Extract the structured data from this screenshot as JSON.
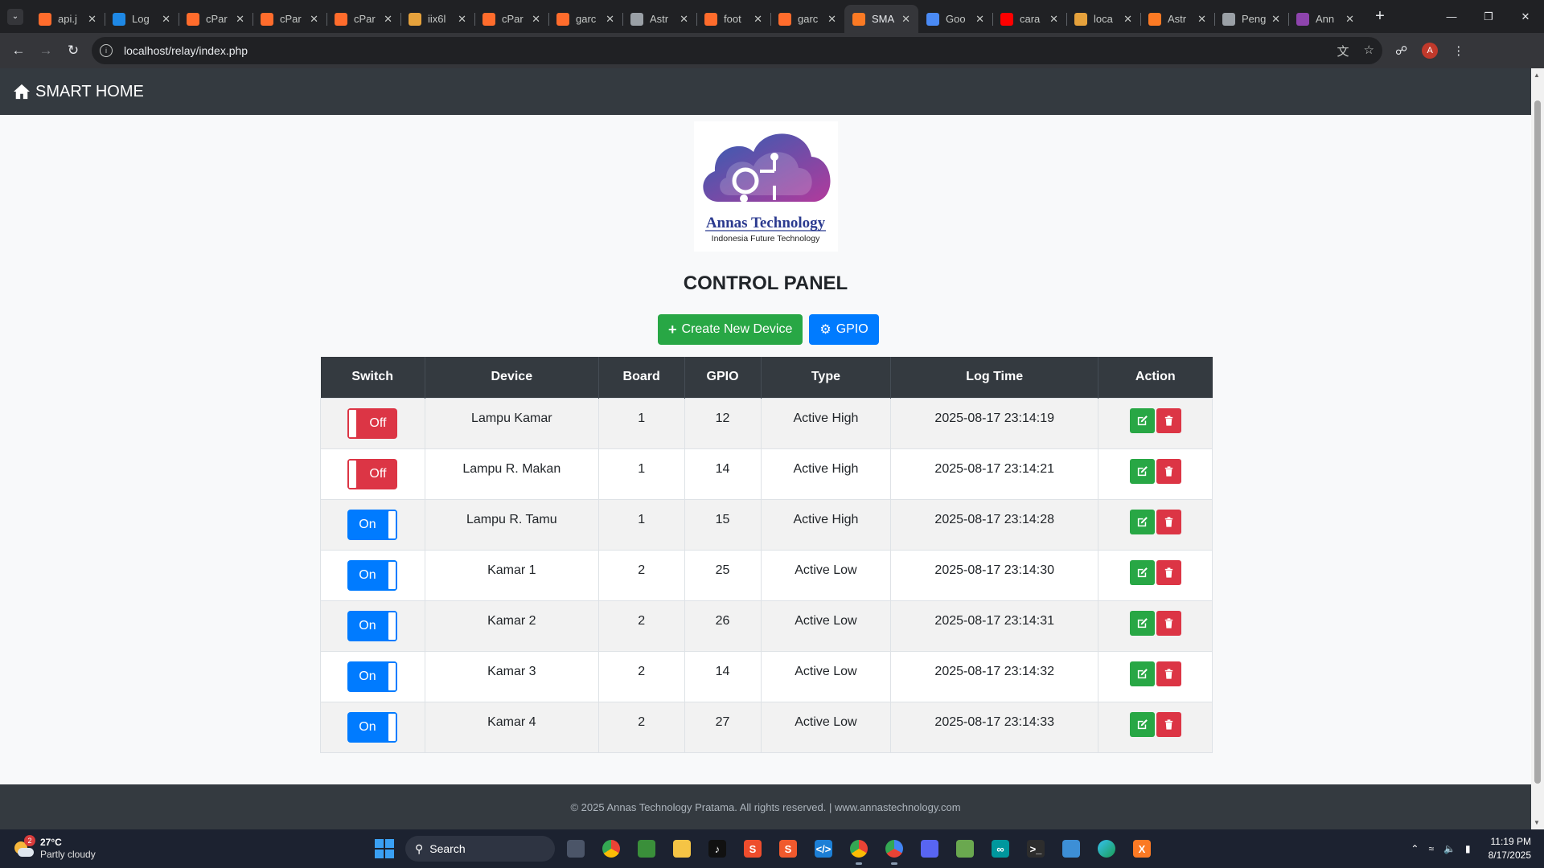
{
  "browser": {
    "tabs": [
      {
        "title": "api.j",
        "icon": "cpanel-icon",
        "color": "#ff6c2c"
      },
      {
        "title": "Log",
        "icon": "cloud-icon",
        "color": "#1e88e5"
      },
      {
        "title": "cPar",
        "icon": "cpanel-icon",
        "color": "#ff6c2c"
      },
      {
        "title": "cPar",
        "icon": "cpanel-icon",
        "color": "#ff6c2c"
      },
      {
        "title": "cPar",
        "icon": "cpanel-icon",
        "color": "#ff6c2c"
      },
      {
        "title": "iix6l",
        "icon": "mountain-icon",
        "color": "#e6a23c"
      },
      {
        "title": "cPar",
        "icon": "cpanel-icon",
        "color": "#ff6c2c"
      },
      {
        "title": "garc",
        "icon": "cpanel-icon",
        "color": "#ff6c2c"
      },
      {
        "title": "Astr",
        "icon": "globe-icon",
        "color": "#9aa0a6"
      },
      {
        "title": "foot",
        "icon": "cpanel-icon",
        "color": "#ff6c2c"
      },
      {
        "title": "garc",
        "icon": "cpanel-icon",
        "color": "#ff6c2c"
      },
      {
        "title": "SMA",
        "icon": "xampp-icon",
        "color": "#fb7a24",
        "active": true
      },
      {
        "title": "Goo",
        "icon": "gemini-icon",
        "color": "#4a8af4"
      },
      {
        "title": "cara",
        "icon": "youtube-icon",
        "color": "#ff0000"
      },
      {
        "title": "loca",
        "icon": "mountain-icon",
        "color": "#e6a23c"
      },
      {
        "title": "Astr",
        "icon": "xampp-icon",
        "color": "#fb7a24"
      },
      {
        "title": "Peng",
        "icon": "openai-icon",
        "color": "#9aa0a6"
      },
      {
        "title": "Ann",
        "icon": "logo-icon",
        "color": "#8e44ad"
      }
    ],
    "url": "localhost/relay/index.php",
    "profile_initial": "A"
  },
  "navbar": {
    "brand": "SMART HOME"
  },
  "logo": {
    "name": "Annas Technology",
    "tagline": "Indonesia Future Technology"
  },
  "page_title": "CONTROL PANEL",
  "buttons": {
    "create": "Create New Device",
    "gpio": "GPIO"
  },
  "table": {
    "headers": [
      "Switch",
      "Device",
      "Board",
      "GPIO",
      "Type",
      "Log Time",
      "Action"
    ],
    "rows": [
      {
        "state": "Off",
        "device": "Lampu Kamar",
        "board": "1",
        "gpio": "12",
        "type": "Active High",
        "log_time": "2025-08-17 23:14:19"
      },
      {
        "state": "Off",
        "device": "Lampu R. Makan",
        "board": "1",
        "gpio": "14",
        "type": "Active High",
        "log_time": "2025-08-17 23:14:21"
      },
      {
        "state": "On",
        "device": "Lampu R. Tamu",
        "board": "1",
        "gpio": "15",
        "type": "Active High",
        "log_time": "2025-08-17 23:14:28"
      },
      {
        "state": "On",
        "device": "Kamar 1",
        "board": "2",
        "gpio": "25",
        "type": "Active Low",
        "log_time": "2025-08-17 23:14:30"
      },
      {
        "state": "On",
        "device": "Kamar 2",
        "board": "2",
        "gpio": "26",
        "type": "Active Low",
        "log_time": "2025-08-17 23:14:31"
      },
      {
        "state": "On",
        "device": "Kamar 3",
        "board": "2",
        "gpio": "14",
        "type": "Active Low",
        "log_time": "2025-08-17 23:14:32"
      },
      {
        "state": "On",
        "device": "Kamar 4",
        "board": "2",
        "gpio": "27",
        "type": "Active Low",
        "log_time": "2025-08-17 23:14:33"
      }
    ]
  },
  "footer": {
    "text": "© 2025 Annas Technology Pratama. All rights reserved. | www.annastechnology.com"
  },
  "taskbar": {
    "weather": {
      "temp": "27°C",
      "desc": "Partly cloudy",
      "badge": "2"
    },
    "search_label": "Search",
    "time": "11:19 PM",
    "date": "8/17/2025"
  },
  "colors": {
    "navbar": "#343a40",
    "on": "#007bff",
    "off": "#dc3545",
    "edit": "#28a745",
    "delete": "#dc3545"
  }
}
